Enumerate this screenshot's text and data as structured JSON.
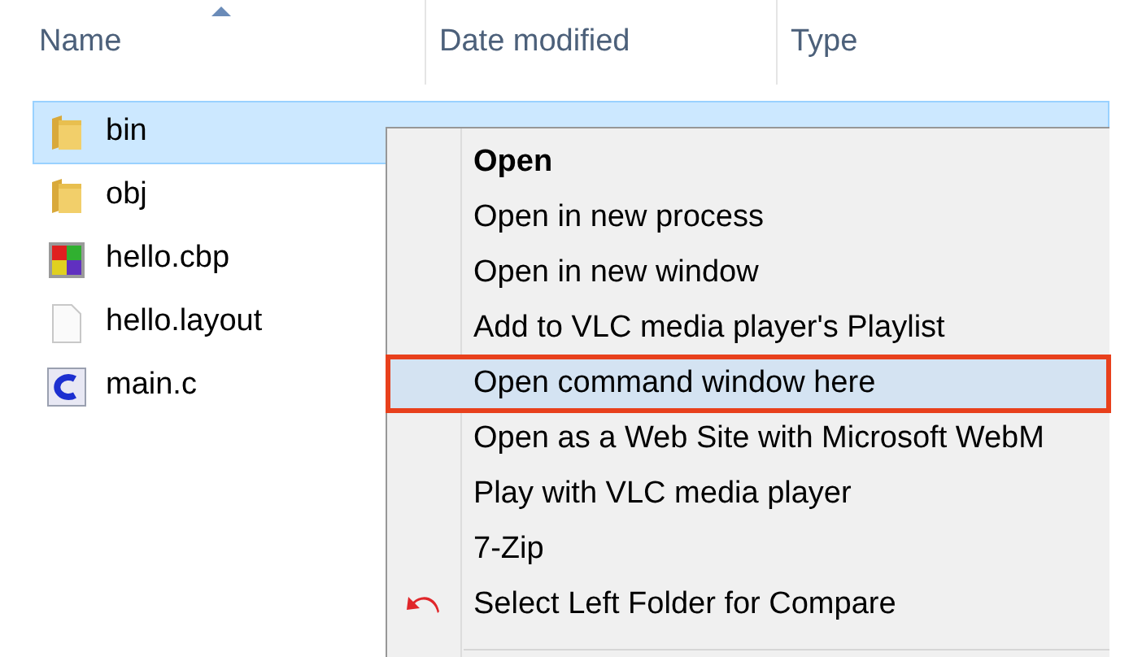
{
  "columns": [
    {
      "label": "Name",
      "sorted": true
    },
    {
      "label": "Date modified",
      "sorted": false
    },
    {
      "label": "Type",
      "sorted": false
    }
  ],
  "files": [
    {
      "name": "bin",
      "kind": "folder",
      "selected": true
    },
    {
      "name": "obj",
      "kind": "folder",
      "selected": false
    },
    {
      "name": "hello.cbp",
      "kind": "project",
      "selected": false
    },
    {
      "name": "hello.layout",
      "kind": "document",
      "selected": false
    },
    {
      "name": "main.c",
      "kind": "c-source",
      "selected": false
    }
  ],
  "context_menu": {
    "items": [
      {
        "label": "Open",
        "default": true,
        "selected": false,
        "kind": "plain"
      },
      {
        "label": "Open in new process",
        "default": false,
        "selected": false,
        "kind": "plain"
      },
      {
        "label": "Open in new window",
        "default": false,
        "selected": false,
        "kind": "plain"
      },
      {
        "label": "Add to VLC media player's Playlist",
        "default": false,
        "selected": false,
        "kind": "plain"
      },
      {
        "label": "Open command window here",
        "default": false,
        "selected": true,
        "kind": "plain"
      },
      {
        "label": "Open as a Web Site with Microsoft WebM",
        "default": false,
        "selected": false,
        "kind": "plain"
      },
      {
        "label": "Play with VLC media player",
        "default": false,
        "selected": false,
        "kind": "plain"
      },
      {
        "label": "7-Zip",
        "default": false,
        "selected": false,
        "kind": "plain"
      },
      {
        "label": "Select Left Folder for Compare",
        "default": false,
        "selected": false,
        "kind": "compare"
      }
    ]
  }
}
